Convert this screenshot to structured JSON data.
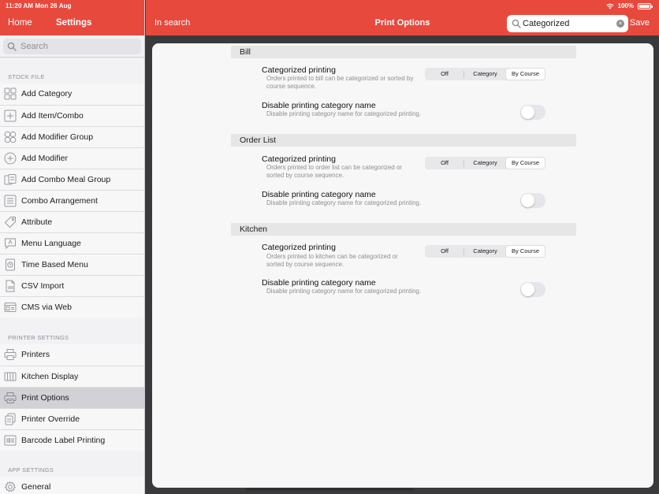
{
  "status": {
    "time_date": "11:20 AM   Mon 26 Aug",
    "battery": "100%"
  },
  "sidebar": {
    "home_label": "Home",
    "title": "Settings",
    "search_placeholder": "Search",
    "sections": [
      {
        "header": "STOCK FILE",
        "items": [
          {
            "label": "Add Category",
            "icon": "grid-icon"
          },
          {
            "label": "Add Item/Combo",
            "icon": "plus-square-icon"
          },
          {
            "label": "Add Modifier Group",
            "icon": "circles-icon"
          },
          {
            "label": "Add Modifier",
            "icon": "plus-circle-icon"
          },
          {
            "label": "Add Combo Meal Group",
            "icon": "stack-icon"
          },
          {
            "label": "Combo Arrangement",
            "icon": "list-icon"
          },
          {
            "label": "Attribute",
            "icon": "tag-icon"
          },
          {
            "label": "Menu Language",
            "icon": "speech-bubble-icon"
          },
          {
            "label": "Time Based Menu",
            "icon": "clock-icon"
          },
          {
            "label": "CSV Import",
            "icon": "csv-icon"
          },
          {
            "label": "CMS via Web",
            "icon": "web-icon"
          }
        ]
      },
      {
        "header": "PRINTER SETTINGS",
        "items": [
          {
            "label": "Printers",
            "icon": "printer-icon"
          },
          {
            "label": "Kitchen Display",
            "icon": "display-icon"
          },
          {
            "label": "Print Options",
            "icon": "print-options-icon",
            "active": true
          },
          {
            "label": "Printer Override",
            "icon": "document-icon"
          },
          {
            "label": "Barcode Label Printing",
            "icon": "barcode-icon"
          }
        ]
      },
      {
        "header": "APP SETTINGS",
        "items": [
          {
            "label": "General",
            "icon": "gear-icon"
          }
        ]
      }
    ]
  },
  "topbar": {
    "back_label": "In search",
    "title": "Print Options",
    "search_value": "Categorized",
    "save_label": "Save"
  },
  "content": {
    "segment_options": [
      "Off",
      "Category",
      "By Course"
    ],
    "sections": [
      {
        "title": "Bill",
        "categorized": {
          "title": "Categorized printing",
          "desc": "Orders printed to bill can be categorized or sorted by course sequence.",
          "selected": "By Course"
        },
        "disable": {
          "title": "Disable printing category name",
          "desc": "Disable printing category name for categorized printing.",
          "on": false
        }
      },
      {
        "title": "Order List",
        "categorized": {
          "title": "Categorized printing",
          "desc": "Orders printed to order list can be categorized or sorted by course sequence.",
          "selected": "By Course"
        },
        "disable": {
          "title": "Disable printing category name",
          "desc": "Disable printing category name for categorized printing.",
          "on": false
        }
      },
      {
        "title": "Kitchen",
        "categorized": {
          "title": "Categorized printing",
          "desc": "Orders printed to kitchen can be categorized or sorted by course sequence.",
          "selected": "By Course"
        },
        "disable": {
          "title": "Disable printing category name",
          "desc": "Disable printing category name for categorized printing.",
          "on": false
        }
      }
    ]
  },
  "colors": {
    "accent": "#e8493d",
    "active_row": "#d1d1d6"
  }
}
